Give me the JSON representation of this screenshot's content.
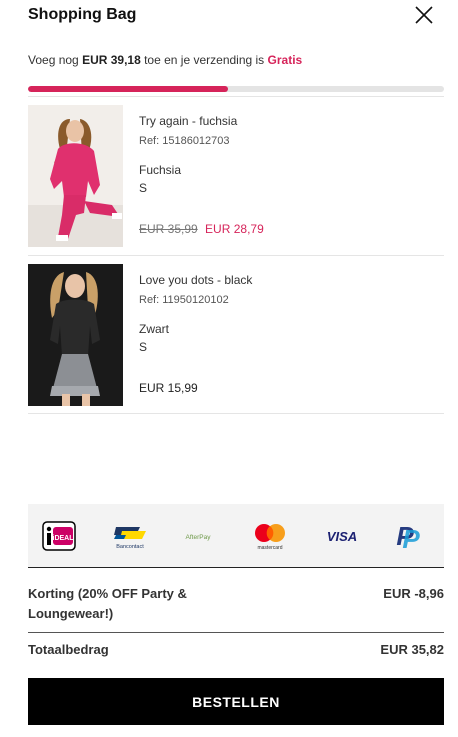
{
  "header": {
    "title": "Shopping Bag"
  },
  "shipping": {
    "prefix": "Voeg nog ",
    "amount": "EUR 39,18",
    "middle": " toe en je verzending is ",
    "free_label": "Gratis",
    "progress_fraction": 0.48
  },
  "items": [
    {
      "name": "Try again - fuchsia",
      "ref": "Ref: 15186012703",
      "color": "Fuchsia",
      "size": "S",
      "old_price": "EUR 35,99",
      "price": "EUR 28,79"
    },
    {
      "name": "Love you dots - black",
      "ref": "Ref: 11950120102",
      "color": "Zwart",
      "size": "S",
      "price": "EUR 15,99"
    }
  ],
  "payments": {
    "ideal_text": "iDEAL",
    "bancontact_text": "Bancontact",
    "afterpay_text": "AfterPay",
    "mastercard_text": "mastercard",
    "visa_text": "VISA",
    "paypal_text": "P"
  },
  "summary": {
    "discount_label": "Korting (20% OFF Party & Loungewear!)",
    "discount_value": "EUR -8,96",
    "total_label": "Totaalbedrag",
    "total_value": "EUR 35,82"
  },
  "checkout": {
    "label": "BESTELLEN"
  },
  "colors": {
    "accent": "#d6245a",
    "button": "#000000"
  }
}
